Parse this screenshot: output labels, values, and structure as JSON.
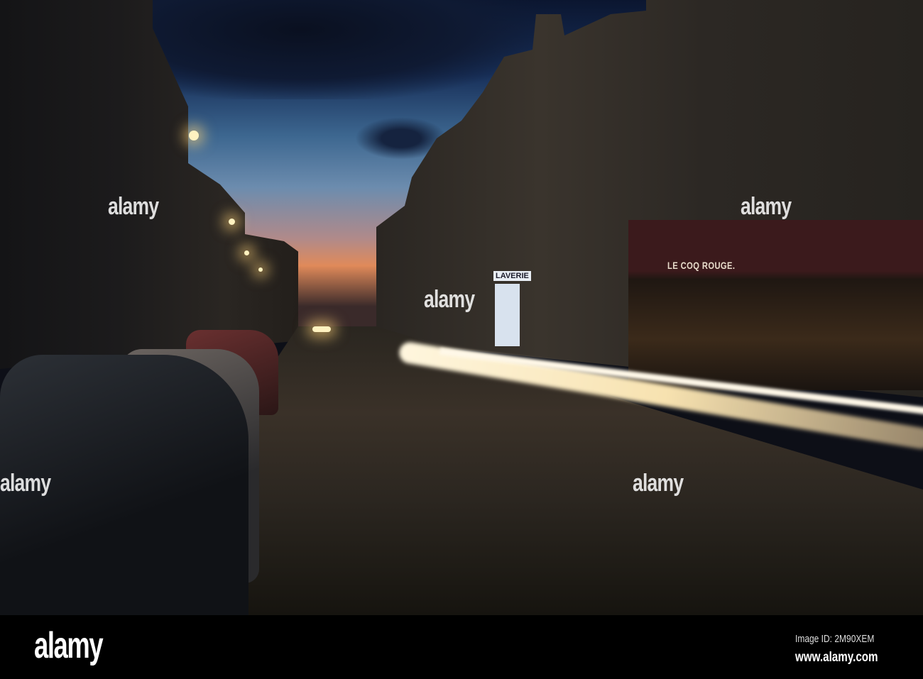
{
  "photo": {
    "storefront_sign": "LE COQ ROUGE.",
    "laundry_sign": "LAVERIE",
    "watermark": "alamy"
  },
  "footer": {
    "logo": "alamy",
    "image_id": "Image ID: 2M90XEM",
    "website": "www.alamy.com"
  }
}
